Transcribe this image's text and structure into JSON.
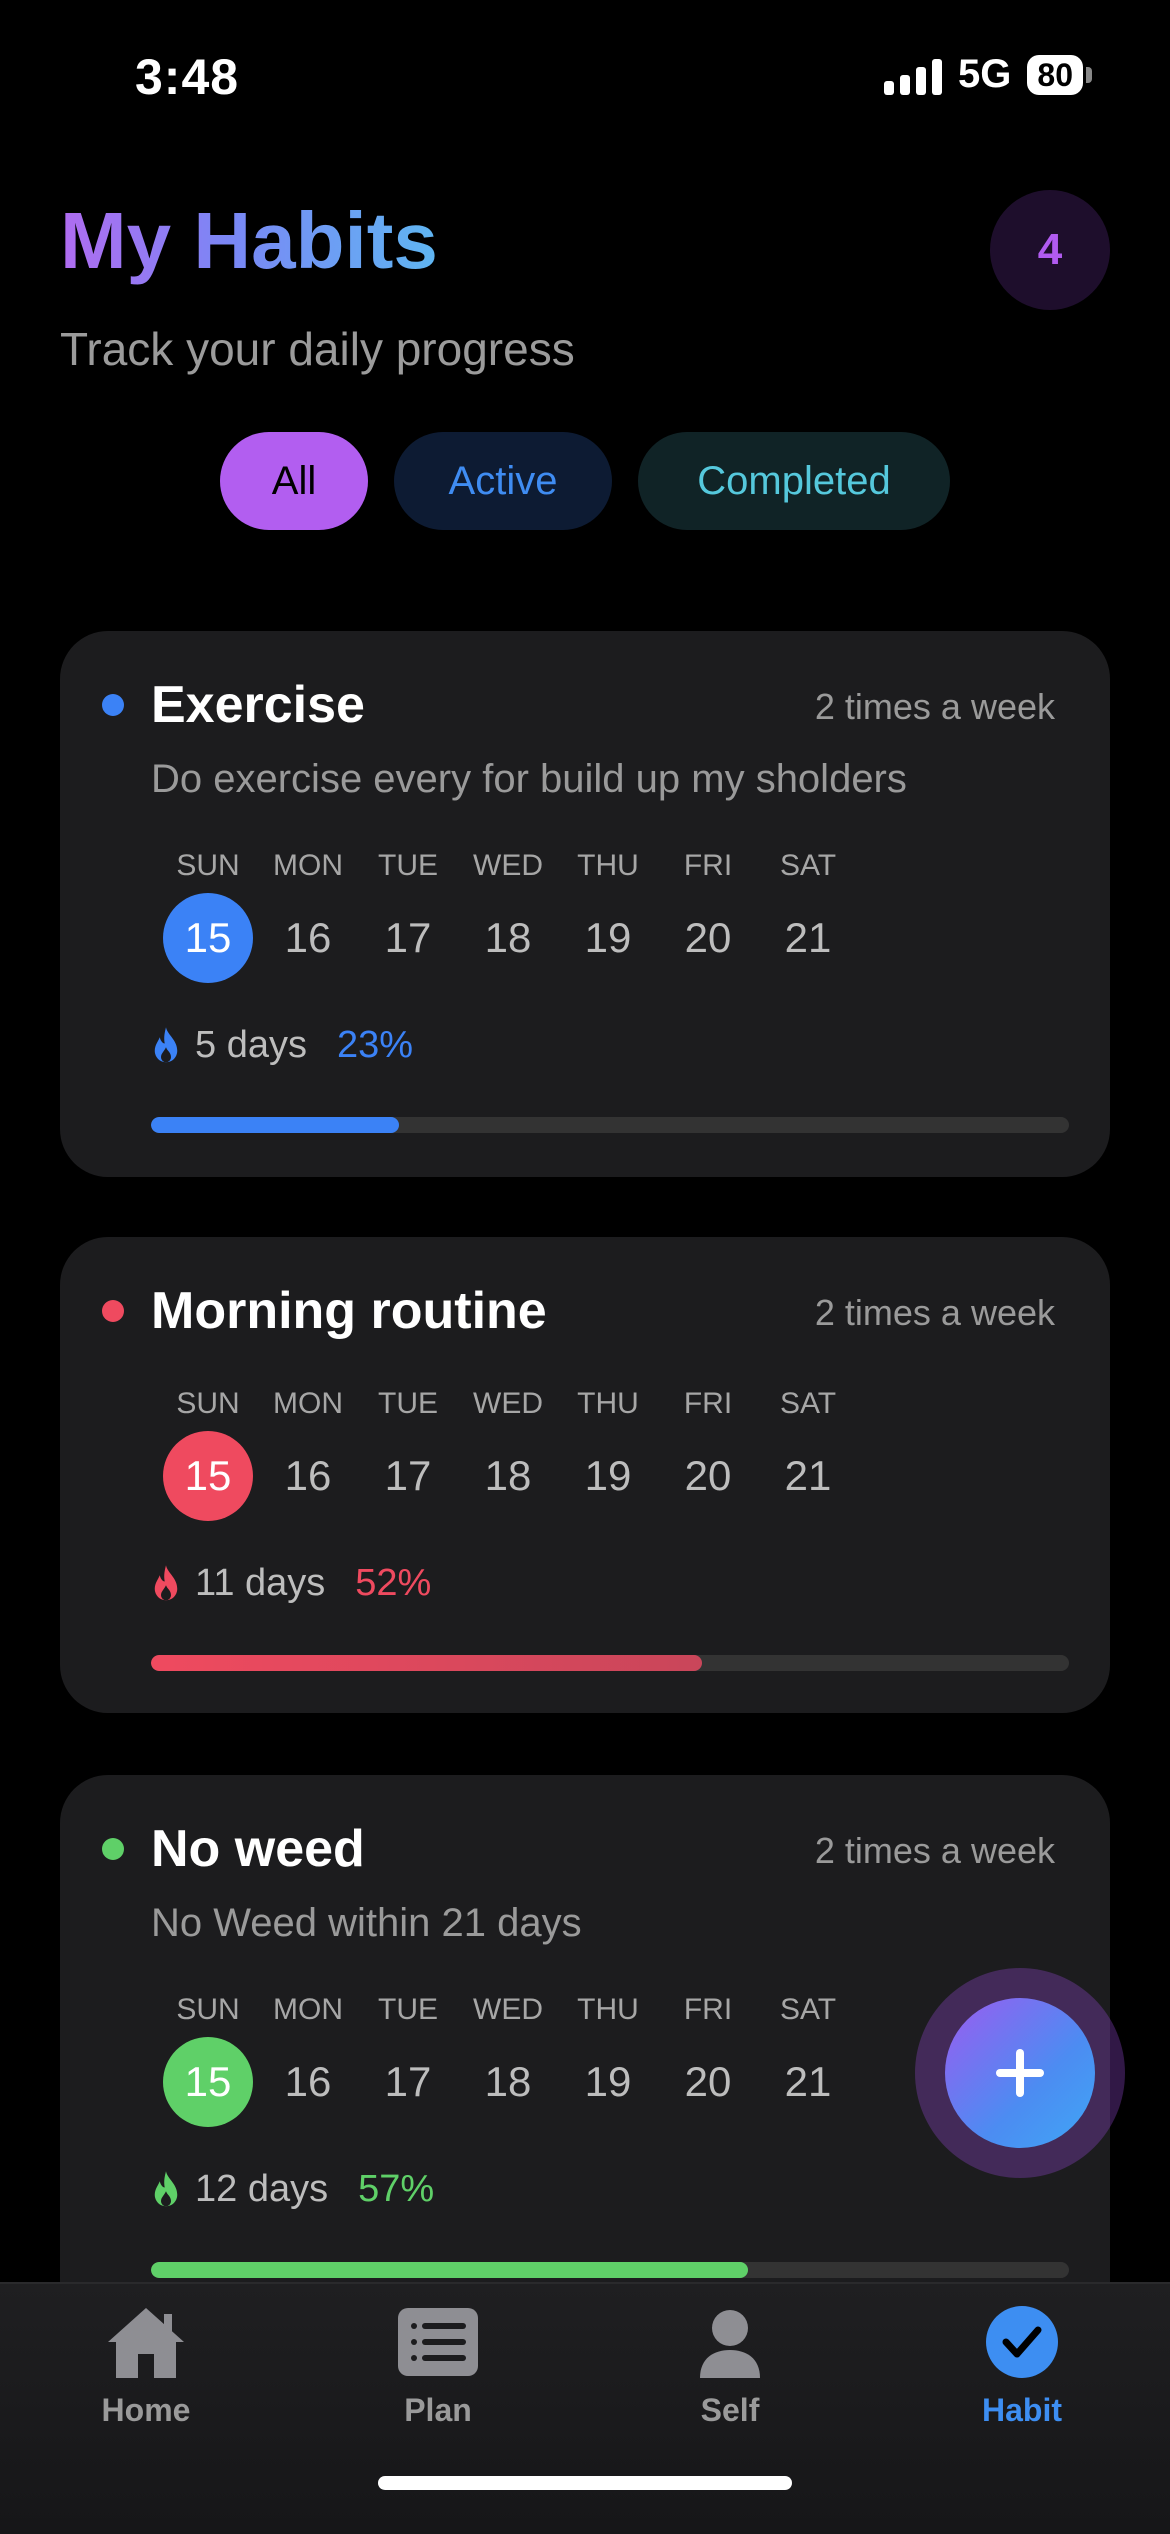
{
  "status_bar": {
    "time": "3:48",
    "network": "5G",
    "battery": "80"
  },
  "header": {
    "title": "My Habits",
    "subtitle": "Track your daily progress",
    "habit_count": "4"
  },
  "filters": [
    {
      "label": "All",
      "selected": true
    },
    {
      "label": "Active",
      "selected": false
    },
    {
      "label": "Completed",
      "selected": false
    }
  ],
  "colors": {
    "exercise": "#3b82f6",
    "morning": "#ef4a5f",
    "noweed": "#5fd068",
    "accent": "#b25ef0"
  },
  "habits": [
    {
      "title": "Exercise",
      "frequency": "2 times a week",
      "description": "Do exercise every for build up my sholders",
      "days": [
        {
          "name": "SUN",
          "num": "15"
        },
        {
          "name": "MON",
          "num": "16"
        },
        {
          "name": "TUE",
          "num": "17"
        },
        {
          "name": "WED",
          "num": "18"
        },
        {
          "name": "THU",
          "num": "19"
        },
        {
          "name": "FRI",
          "num": "20"
        },
        {
          "name": "SAT",
          "num": "21"
        }
      ],
      "selected_day": "15",
      "streak": "5 days",
      "percent": "23%",
      "progress": 0.27
    },
    {
      "title": "Morning routine",
      "frequency": "2 times a week",
      "days": [
        {
          "name": "SUN",
          "num": "15"
        },
        {
          "name": "MON",
          "num": "16"
        },
        {
          "name": "TUE",
          "num": "17"
        },
        {
          "name": "WED",
          "num": "18"
        },
        {
          "name": "THU",
          "num": "19"
        },
        {
          "name": "FRI",
          "num": "20"
        },
        {
          "name": "SAT",
          "num": "21"
        }
      ],
      "selected_day": "15",
      "streak": "11 days",
      "percent": "52%",
      "progress": 0.6
    },
    {
      "title": "No weed",
      "frequency": "2 times a week",
      "description": "No Weed within 21 days",
      "days": [
        {
          "name": "SUN",
          "num": "15"
        },
        {
          "name": "MON",
          "num": "16"
        },
        {
          "name": "TUE",
          "num": "17"
        },
        {
          "name": "WED",
          "num": "18"
        },
        {
          "name": "THU",
          "num": "19"
        },
        {
          "name": "FRI",
          "num": "20"
        },
        {
          "name": "SAT",
          "num": "21"
        }
      ],
      "selected_day": "15",
      "streak": "12 days",
      "percent": "57%",
      "progress": 0.65
    }
  ],
  "fab": {
    "icon": "plus-icon"
  },
  "tabs": [
    {
      "label": "Home",
      "icon": "home-icon",
      "active": false
    },
    {
      "label": "Plan",
      "icon": "list-icon",
      "active": false
    },
    {
      "label": "Self",
      "icon": "person-icon",
      "active": false
    },
    {
      "label": "Habit",
      "icon": "check-circle-icon",
      "active": true
    }
  ]
}
